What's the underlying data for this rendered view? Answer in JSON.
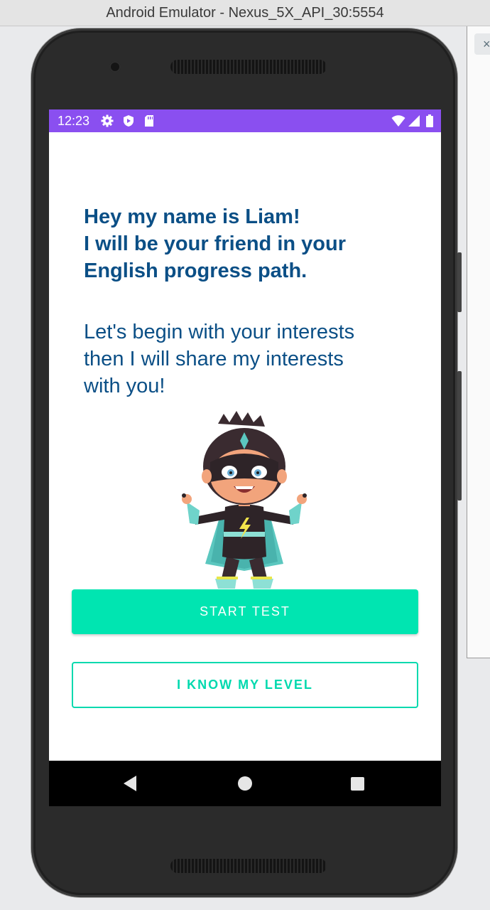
{
  "window": {
    "title": "Android Emulator - Nexus_5X_API_30:5554"
  },
  "side_panel": {
    "close_glyph": "×"
  },
  "status_bar": {
    "time": "12:23",
    "color": "#8a4ff0",
    "left_icons": [
      "gear-icon",
      "shield-icon",
      "sd-card-icon"
    ],
    "right_icons": [
      "wifi-icon",
      "cell-signal-icon",
      "battery-icon"
    ]
  },
  "intro": {
    "heading_lines": [
      "Hey my name is Liam!",
      "I will be your friend in your",
      "English progress path."
    ],
    "body_lines": [
      "Let's begin with your interests",
      "then I will share my interests",
      "with you!"
    ],
    "text_color": "#0b4f86"
  },
  "mascot": {
    "icon": "superhero-mascot-illustration"
  },
  "actions": {
    "primary_label": "START TEST",
    "secondary_label": "I KNOW MY LEVEL",
    "accent_color": "#00e5b1"
  },
  "nav_bar": {
    "buttons": [
      "back-icon",
      "home-icon",
      "recents-icon"
    ]
  }
}
